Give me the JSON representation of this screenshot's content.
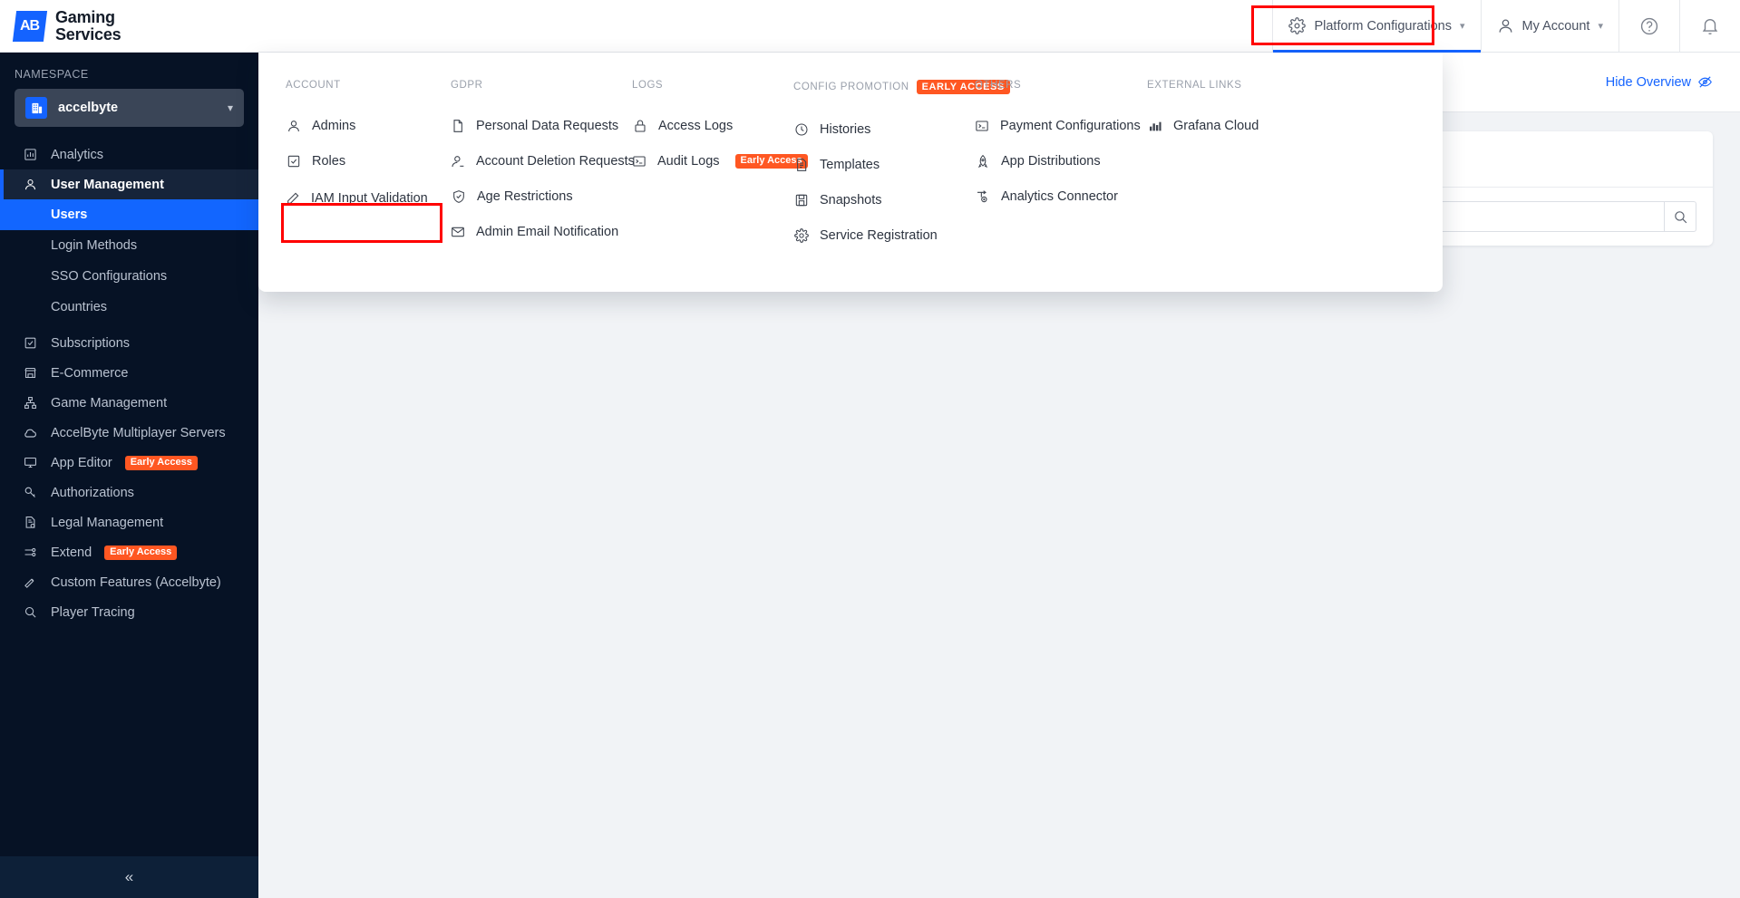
{
  "header": {
    "logo_line1": "Gaming",
    "logo_line2": "Services",
    "logo_mark": "AB",
    "platform_configurations": "Platform Configurations",
    "my_account": "My Account",
    "help_icon": "help-circle-icon",
    "notification_icon": "bell-icon",
    "gear_icon": "gear-icon",
    "user_icon": "user-icon"
  },
  "sidebar": {
    "namespace_label": "NAMESPACE",
    "namespace_value": "accelbyte",
    "items": [
      {
        "label": "Analytics",
        "icon": "bar-chart-icon"
      },
      {
        "label": "User Management",
        "icon": "user-icon",
        "active": true
      },
      {
        "label": "Subscriptions",
        "icon": "check-square-icon"
      },
      {
        "label": "E-Commerce",
        "icon": "storefront-icon"
      },
      {
        "label": "Game Management",
        "icon": "sitemap-icon"
      },
      {
        "label": "AccelByte Multiplayer Servers",
        "icon": "cloud-icon"
      },
      {
        "label": "App Editor",
        "icon": "monitor-icon",
        "badge": "Early Access"
      },
      {
        "label": "Authorizations",
        "icon": "key-icon"
      },
      {
        "label": "Legal Management",
        "icon": "document-check-icon"
      },
      {
        "label": "Extend",
        "icon": "extend-icon",
        "badge": "Early Access"
      },
      {
        "label": "Custom Features (Accelbyte)",
        "icon": "wand-icon"
      },
      {
        "label": "Player Tracing",
        "icon": "search-icon"
      }
    ],
    "subitems": [
      {
        "label": "Users",
        "selected": true
      },
      {
        "label": "Login Methods"
      },
      {
        "label": "SSO Configurations"
      },
      {
        "label": "Countries"
      }
    ],
    "collapse_icon": "chevron-double-left-icon"
  },
  "main": {
    "hide_overview": "Hide Overview",
    "hide_overview_icon": "eye-slash-icon",
    "search_placeholder": "",
    "search_value": "",
    "search_icon": "search-icon"
  },
  "mega_menu": {
    "columns": [
      {
        "heading": "ACCOUNT",
        "items": [
          {
            "label": "Admins",
            "icon": "user-icon"
          },
          {
            "label": "Roles",
            "icon": "check-square-icon"
          },
          {
            "label": "IAM Input Validation",
            "icon": "pencil-icon",
            "highlighted": true
          }
        ]
      },
      {
        "heading": "GDPR",
        "items": [
          {
            "label": "Personal Data Requests",
            "icon": "file-icon"
          },
          {
            "label": "Account Deletion Requests",
            "icon": "user-minus-icon"
          },
          {
            "label": "Age Restrictions",
            "icon": "shield-check-icon"
          },
          {
            "label": "Admin Email Notification",
            "icon": "envelope-icon"
          }
        ]
      },
      {
        "heading": "LOGS",
        "items": [
          {
            "label": "Access Logs",
            "icon": "lock-icon"
          },
          {
            "label": "Audit Logs",
            "icon": "terminal-icon",
            "badge": "Early Access"
          }
        ]
      },
      {
        "heading": "CONFIG PROMOTION",
        "heading_badge": "Early Access",
        "items": [
          {
            "label": "Histories",
            "icon": "clock-icon"
          },
          {
            "label": "Templates",
            "icon": "document-icon"
          },
          {
            "label": "Snapshots",
            "icon": "save-icon"
          },
          {
            "label": "Service Registration",
            "icon": "gear-icon"
          }
        ]
      },
      {
        "heading": "OTHERS",
        "items": [
          {
            "label": "Payment Configurations",
            "icon": "terminal-icon"
          },
          {
            "label": "App Distributions",
            "icon": "rocket-icon"
          },
          {
            "label": "Analytics Connector",
            "icon": "connector-icon"
          }
        ]
      },
      {
        "heading": "EXTERNAL LINKS",
        "items": [
          {
            "label": "Grafana Cloud",
            "icon": "chart-icon"
          }
        ]
      }
    ]
  },
  "colors": {
    "accent_blue": "#1463ff",
    "sidebar_bg": "#061225",
    "early_access_orange": "#ff5722",
    "highlight_red": "#ff0000"
  }
}
